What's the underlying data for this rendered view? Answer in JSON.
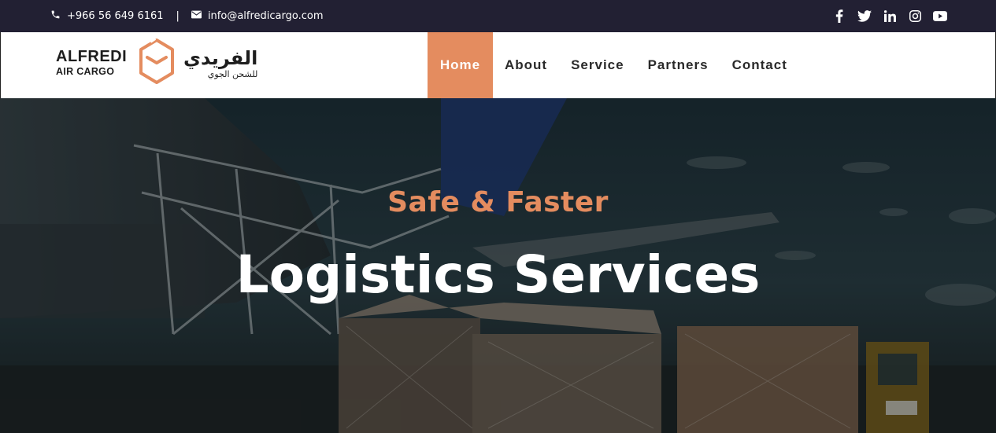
{
  "topbar": {
    "phone_icon": "phone-icon",
    "phone": "+966 56 649 6161",
    "separator": "|",
    "email_icon": "envelope-icon",
    "email": "info@alfredicargo.com",
    "social": [
      "facebook-icon",
      "twitter-icon",
      "linkedin-icon",
      "instagram-icon",
      "youtube-icon"
    ]
  },
  "logo": {
    "name_line1": "ALFREDI",
    "name_line2": "AIR CARGO",
    "arabic_line1": "الفريدي",
    "arabic_line2": "للشحن الجوي"
  },
  "nav": {
    "items": [
      {
        "label": "Home",
        "active": true
      },
      {
        "label": "About",
        "active": false
      },
      {
        "label": "Service",
        "active": false
      },
      {
        "label": "Partners",
        "active": false
      },
      {
        "label": "Contact",
        "active": false
      }
    ]
  },
  "hero": {
    "subtitle": "Safe & Faster",
    "title": "Logistics Services"
  },
  "colors": {
    "accent": "#e48c5f",
    "topbar_bg": "#222033",
    "header_bg": "#ffffff",
    "text_dark": "#2a2a2a"
  }
}
